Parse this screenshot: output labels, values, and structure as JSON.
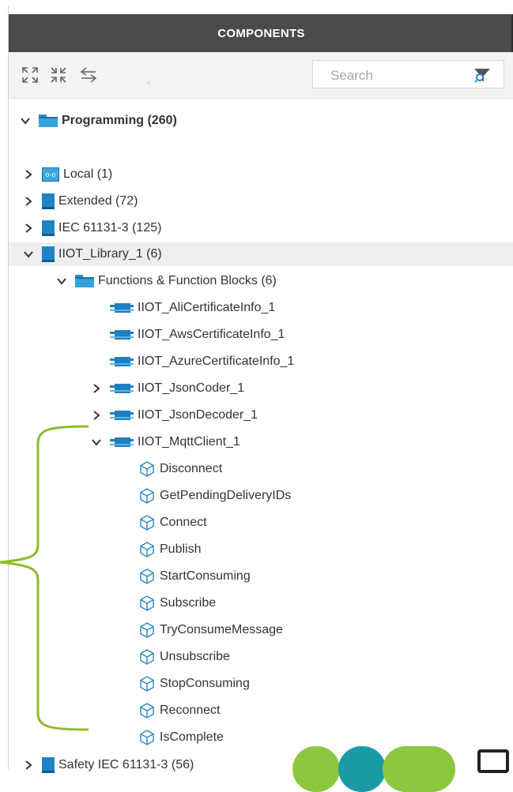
{
  "panel": {
    "title": "COMPONENTS"
  },
  "toolbar": {
    "expand_icon": "expand-all-icon",
    "collapse_icon": "collapse-all-icon",
    "swap_icon": "swap-arrows-icon",
    "search_placeholder": "Search",
    "filter_icon": "filter-search-icon"
  },
  "tree": {
    "root": {
      "label": "Programming (260)",
      "icon": "folder-icon",
      "expanded": true
    },
    "local": {
      "label": "Local (1)",
      "icon": "local-library-icon"
    },
    "extended": {
      "label": "Extended (72)",
      "icon": "library-book-icon"
    },
    "iec": {
      "label": "IEC 61131-3 (125)",
      "icon": "library-book-icon"
    },
    "iiot_lib": {
      "label": "IIOT_Library_1 (6)",
      "icon": "library-book-icon",
      "expanded": true
    },
    "fnfolder": {
      "label": "Functions & Function Blocks (6)",
      "icon": "folder-icon",
      "expanded": true
    },
    "blocks": [
      {
        "label": "IIOT_AliCertificateInfo_1",
        "expandable": false
      },
      {
        "label": "IIOT_AwsCertificateInfo_1",
        "expandable": false
      },
      {
        "label": "IIOT_AzureCertificateInfo_1",
        "expandable": false
      },
      {
        "label": "IIOT_JsonCoder_1",
        "expandable": true
      },
      {
        "label": "IIOT_JsonDecoder_1",
        "expandable": true
      },
      {
        "label": "IIOT_MqttClient_1",
        "expandable": true,
        "expanded": true
      }
    ],
    "methods": [
      "Disconnect",
      "GetPendingDeliveryIDs",
      "Connect",
      "Publish",
      "StartConsuming",
      "Subscribe",
      "TryConsumeMessage",
      "Unsubscribe",
      "StopConsuming",
      "Reconnect",
      "IsComplete"
    ],
    "safety": {
      "label": "Safety IEC 61131-3 (56)",
      "icon": "library-book-icon"
    }
  },
  "colors": {
    "header_bg": "#4a4a4a",
    "accent_blue": "#1f84c6",
    "bracket_green": "#8dbb2a",
    "logo_green": "#8dc63f",
    "logo_teal": "#1b9aa8"
  }
}
